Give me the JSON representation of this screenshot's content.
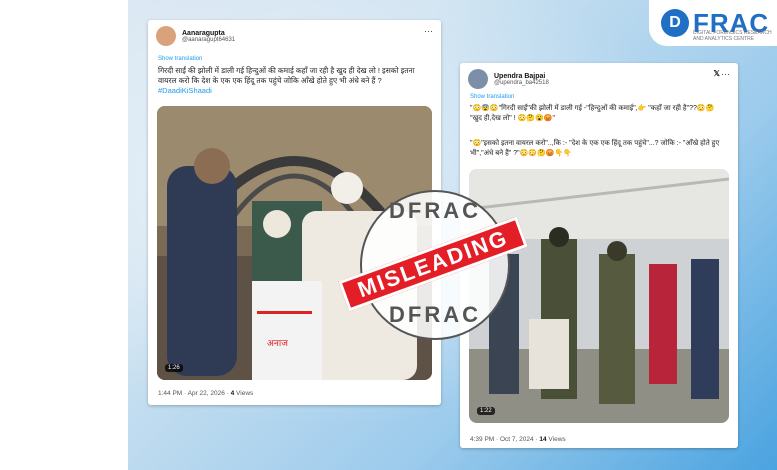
{
  "logo": {
    "text": "FRAC",
    "mark": "D",
    "tagline": "DIGITAL FORENSICS RESEARCH AND ANALYTICS CENTRE"
  },
  "tweet_left": {
    "name": "Aanaragupta",
    "handle": "@aanaragupt64631",
    "show_translation": "Show translation",
    "text": "गिरदी साईं की झोली में डाली गई हिन्दुओं की कमाई कहाँ जा रही है खुद ही देख लो ! इसको इतना वायरल करो कि देश के एक एक हिंदू तक पहुंचे जोकि आँखे होते हुए भी अंधे बने हैं ?",
    "hashtag": "#DaadiKiShaadi",
    "duration": "1:26",
    "time": "1:44 PM · Apr 22, 2026 · ",
    "views": "4",
    "views_label": " Views"
  },
  "tweet_right": {
    "name": "Upendra Bajpai",
    "handle": "@upendra_ba42518",
    "show_translation": "Show translation",
    "text": "\"😳😨😳\"गिरदी साईं\"की झोली में डाली गई -\"हिन्दुओं की कमाई\",👉 \"कहाँ जा रही है\"??😳🤔 \"खुद ही,देख लो\" ! 😳🤔😮😡\"",
    "text2": "\"😳\"इसको इतना वायरल करो\"..,कि :- \"देश के एक एक हिंदू तक पहुंचे\"...? जोकि :- \"आँखे होते हुए भी\",\"अंधे बने हैं\" ?\"😳😳🤔😡👇👇",
    "duration": "1:22",
    "time": "4:39 PM · Oct 7, 2024 · ",
    "views": "14",
    "views_label": " Views"
  },
  "stamp": {
    "top": "DFRAC",
    "bottom": "DFRAC",
    "label": "MISLEADING"
  },
  "colors": {
    "accent": "#e41e26",
    "brand": "#1f6fc5",
    "link": "#1d9bf0"
  }
}
